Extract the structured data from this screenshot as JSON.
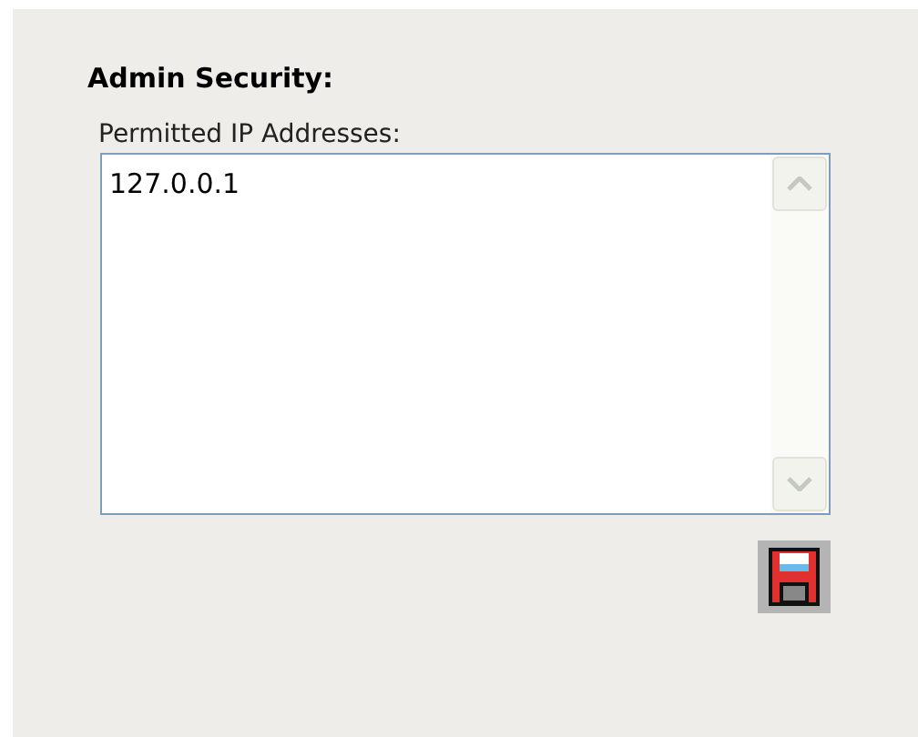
{
  "section": {
    "title": "Admin Security:"
  },
  "ip_field": {
    "label": "Permitted IP Addresses:",
    "value": "127.0.0.1"
  }
}
